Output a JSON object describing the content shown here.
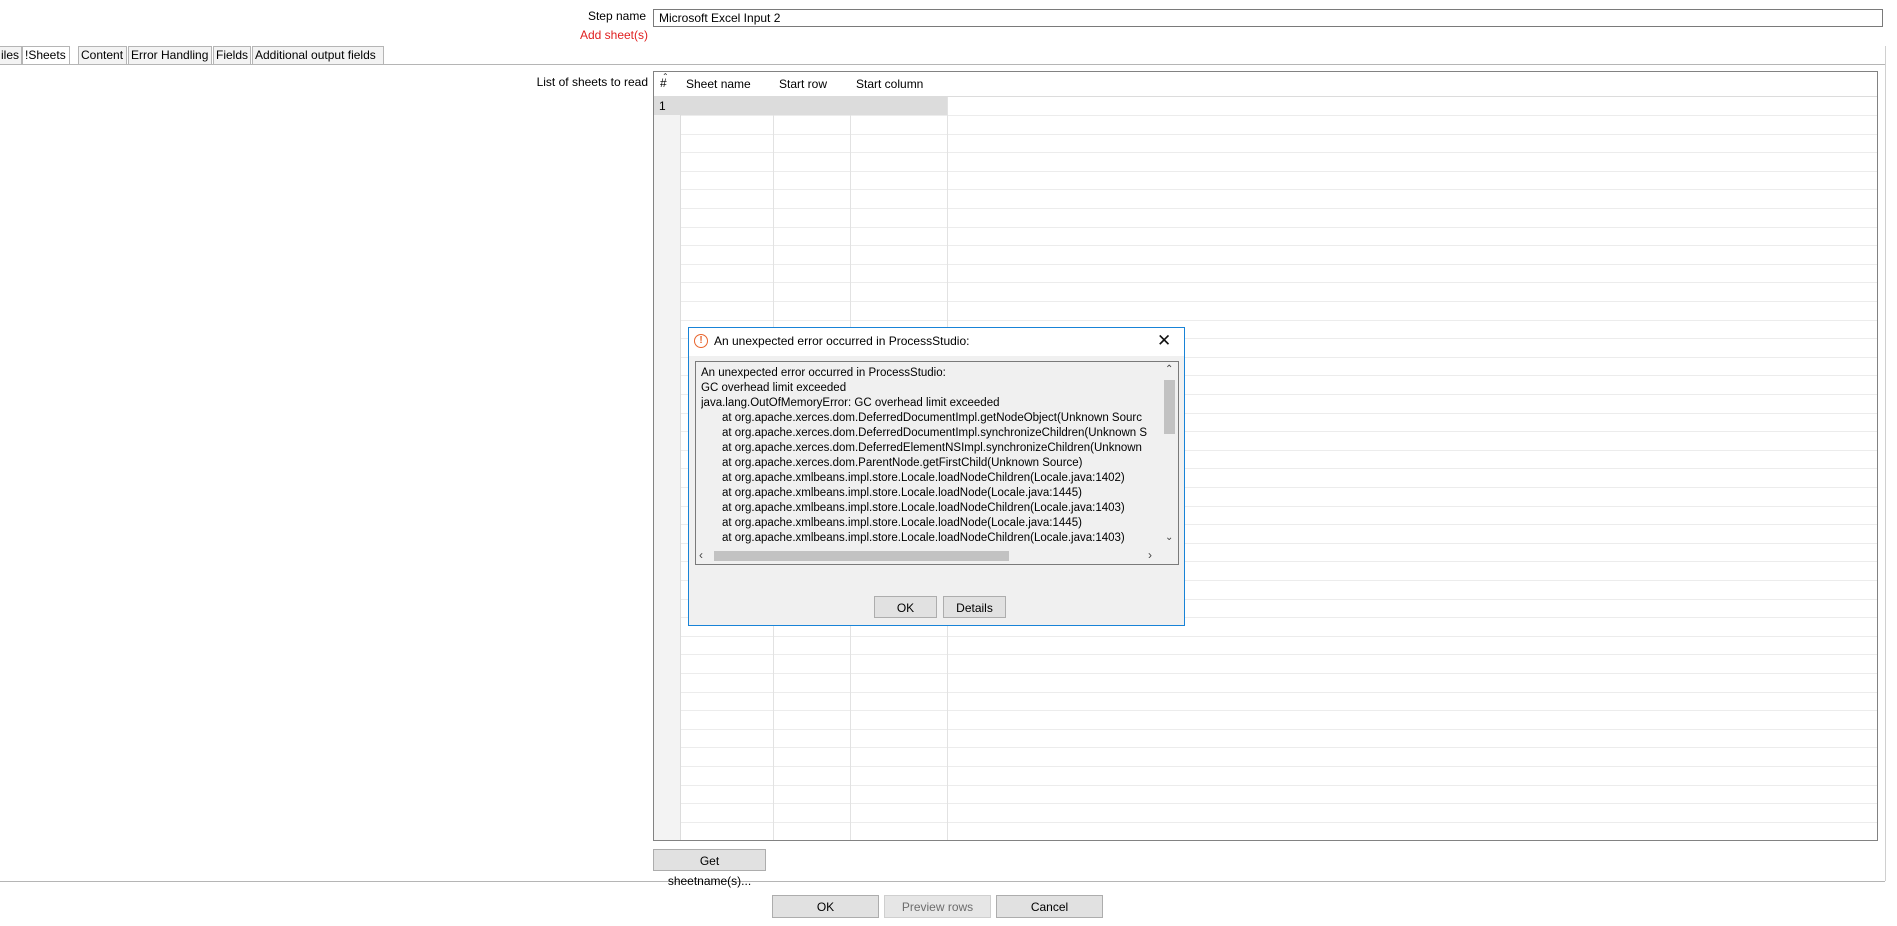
{
  "step": {
    "label": "Step name",
    "value": "Microsoft Excel Input 2",
    "add_sheets_label": "Add sheet(s)"
  },
  "tabs": [
    {
      "label": "iles"
    },
    {
      "label": "!Sheets"
    },
    {
      "label": "Content"
    },
    {
      "label": "Error Handling"
    },
    {
      "label": "Fields"
    },
    {
      "label": "Additional output fields"
    }
  ],
  "sheets": {
    "label": "List of sheets to read",
    "columns": [
      "#",
      "Sheet name",
      "Start row",
      "Start column"
    ],
    "rows": [
      [
        "1",
        "",
        "",
        ""
      ]
    ],
    "get_button": "Get sheetname(s)..."
  },
  "footer": {
    "ok": "OK",
    "preview": "Preview rows",
    "cancel": "Cancel"
  },
  "dialog": {
    "title": "An unexpected error occurred in ProcessStudio:",
    "icon": "warning-circle-icon",
    "lines": [
      "An unexpected error occurred in ProcessStudio:",
      "GC overhead limit exceeded",
      "java.lang.OutOfMemoryError: GC overhead limit exceeded",
      "at org.apache.xerces.dom.DeferredDocumentImpl.getNodeObject(Unknown Sourc",
      "at org.apache.xerces.dom.DeferredDocumentImpl.synchronizeChildren(Unknown S",
      "at org.apache.xerces.dom.DeferredElementNSImpl.synchronizeChildren(Unknown",
      "at org.apache.xerces.dom.ParentNode.getFirstChild(Unknown Source)",
      "at org.apache.xmlbeans.impl.store.Locale.loadNodeChildren(Locale.java:1402)",
      "at org.apache.xmlbeans.impl.store.Locale.loadNode(Locale.java:1445)",
      "at org.apache.xmlbeans.impl.store.Locale.loadNodeChildren(Locale.java:1403)",
      "at org.apache.xmlbeans.impl.store.Locale.loadNode(Locale.java:1445)",
      "at org.apache.xmlbeans.impl.store.Locale.loadNodeChildren(Locale.java:1403)"
    ],
    "ok": "OK",
    "details": "Details",
    "close_icon": "close-icon"
  },
  "colors": {
    "dialog_border": "#1883d7",
    "error_label": "#e02020",
    "warning_icon": "#e8652e"
  }
}
